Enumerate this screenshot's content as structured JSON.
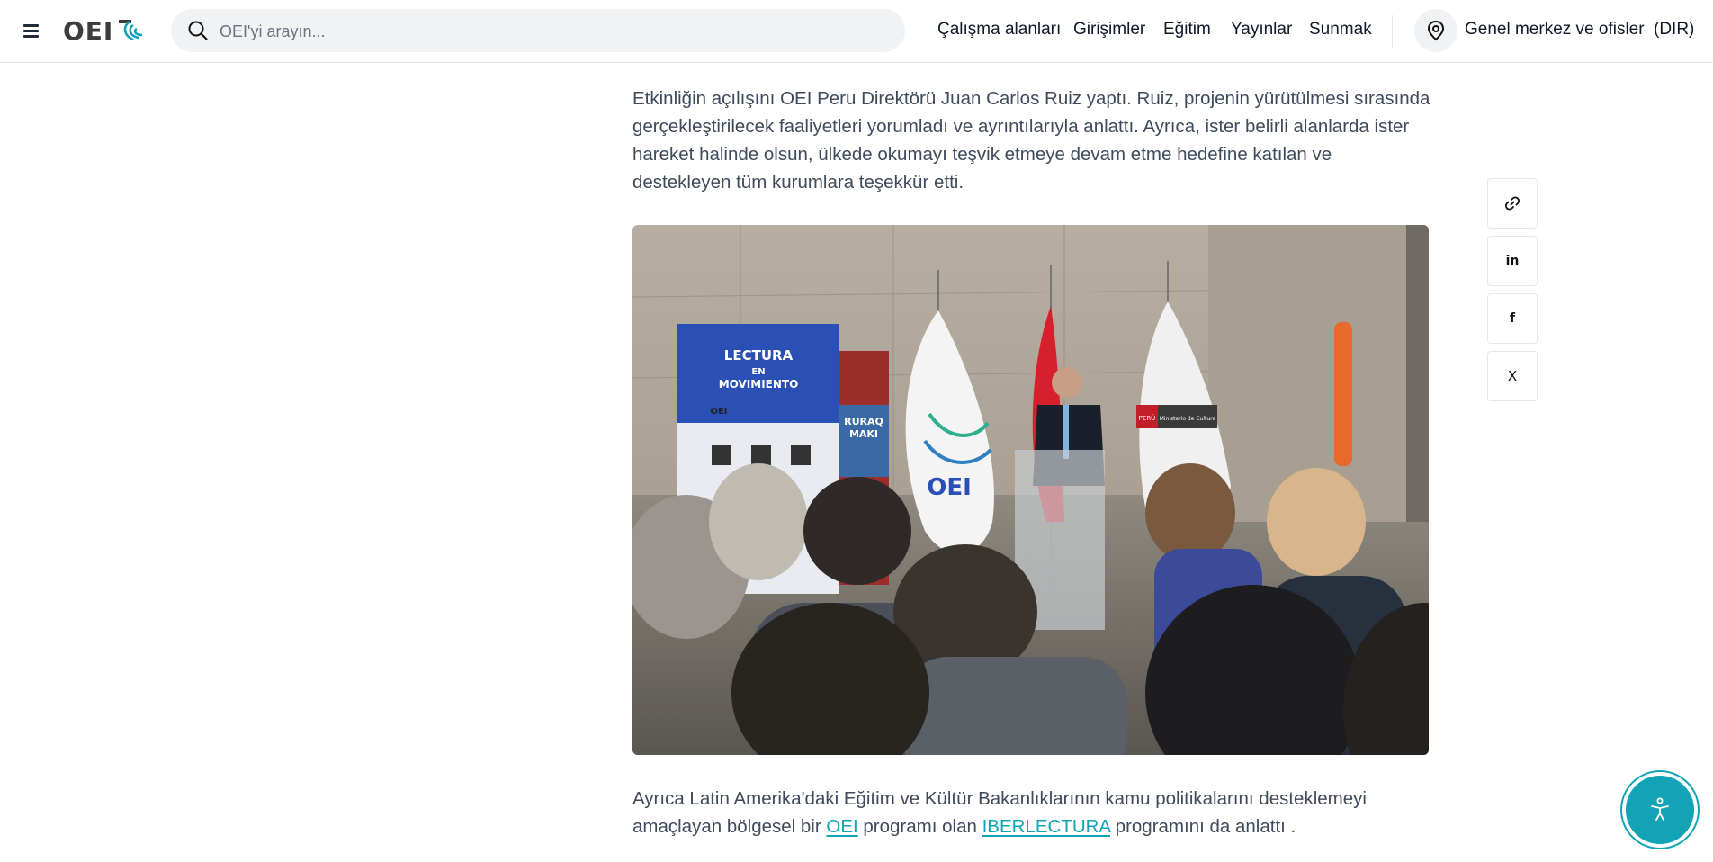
{
  "header": {
    "logo_text": "OEI",
    "search_placeholder": "OEI'yi arayın...",
    "nav": [
      "Çalışma alanları",
      "Girişimler",
      "Eğitim",
      "Yayınlar",
      "Sunmak"
    ],
    "offices_label": "Genel merkez ve ofisler",
    "lang_label": "(DIR)"
  },
  "article": {
    "para1": "Etkinliğin açılışını OEI Peru Direktörü Juan Carlos Ruiz yaptı. Ruiz, projenin yürütülmesi sırasında gerçekleştirilecek faaliyetleri yorumladı ve ayrıntılarıyla anlattı. Ayrıca, ister belirli alanlarda ister hareket halinde olsun, ülkede okumayı teşvik etmeye devam etme hedefine katılan ve destekleyen tüm kurumlara teşekkür etti.",
    "para2_part1": "Ayrıca Latin Amerika'daki Eğitim ve Kültür Bakanlıklarının kamu politikalarını desteklemeyi amaçlayan bölgesel bir ",
    "para2_link1": "OEI",
    "para2_part2": " programı olan ",
    "para2_link2": "IBERLECTURA",
    "para2_part3": " programını da anlattı .",
    "photo": {
      "banner_title_1": "LECTURA",
      "banner_title_2": "EN",
      "banner_title_3": "MOVIMIENTO",
      "banner_org": "OEI",
      "flag_text": "OEI",
      "podium_sign_1": "PERÚ",
      "podium_sign_2": "Ministerio de Cultura",
      "side_banner_1": "RURAQ",
      "side_banner_2": "MAKI"
    }
  },
  "share": {
    "linkedin_label": "in",
    "facebook_label": "f",
    "x_label": "X"
  },
  "colors": {
    "accent": "#13a3b6",
    "text": "#3f4a5a"
  }
}
